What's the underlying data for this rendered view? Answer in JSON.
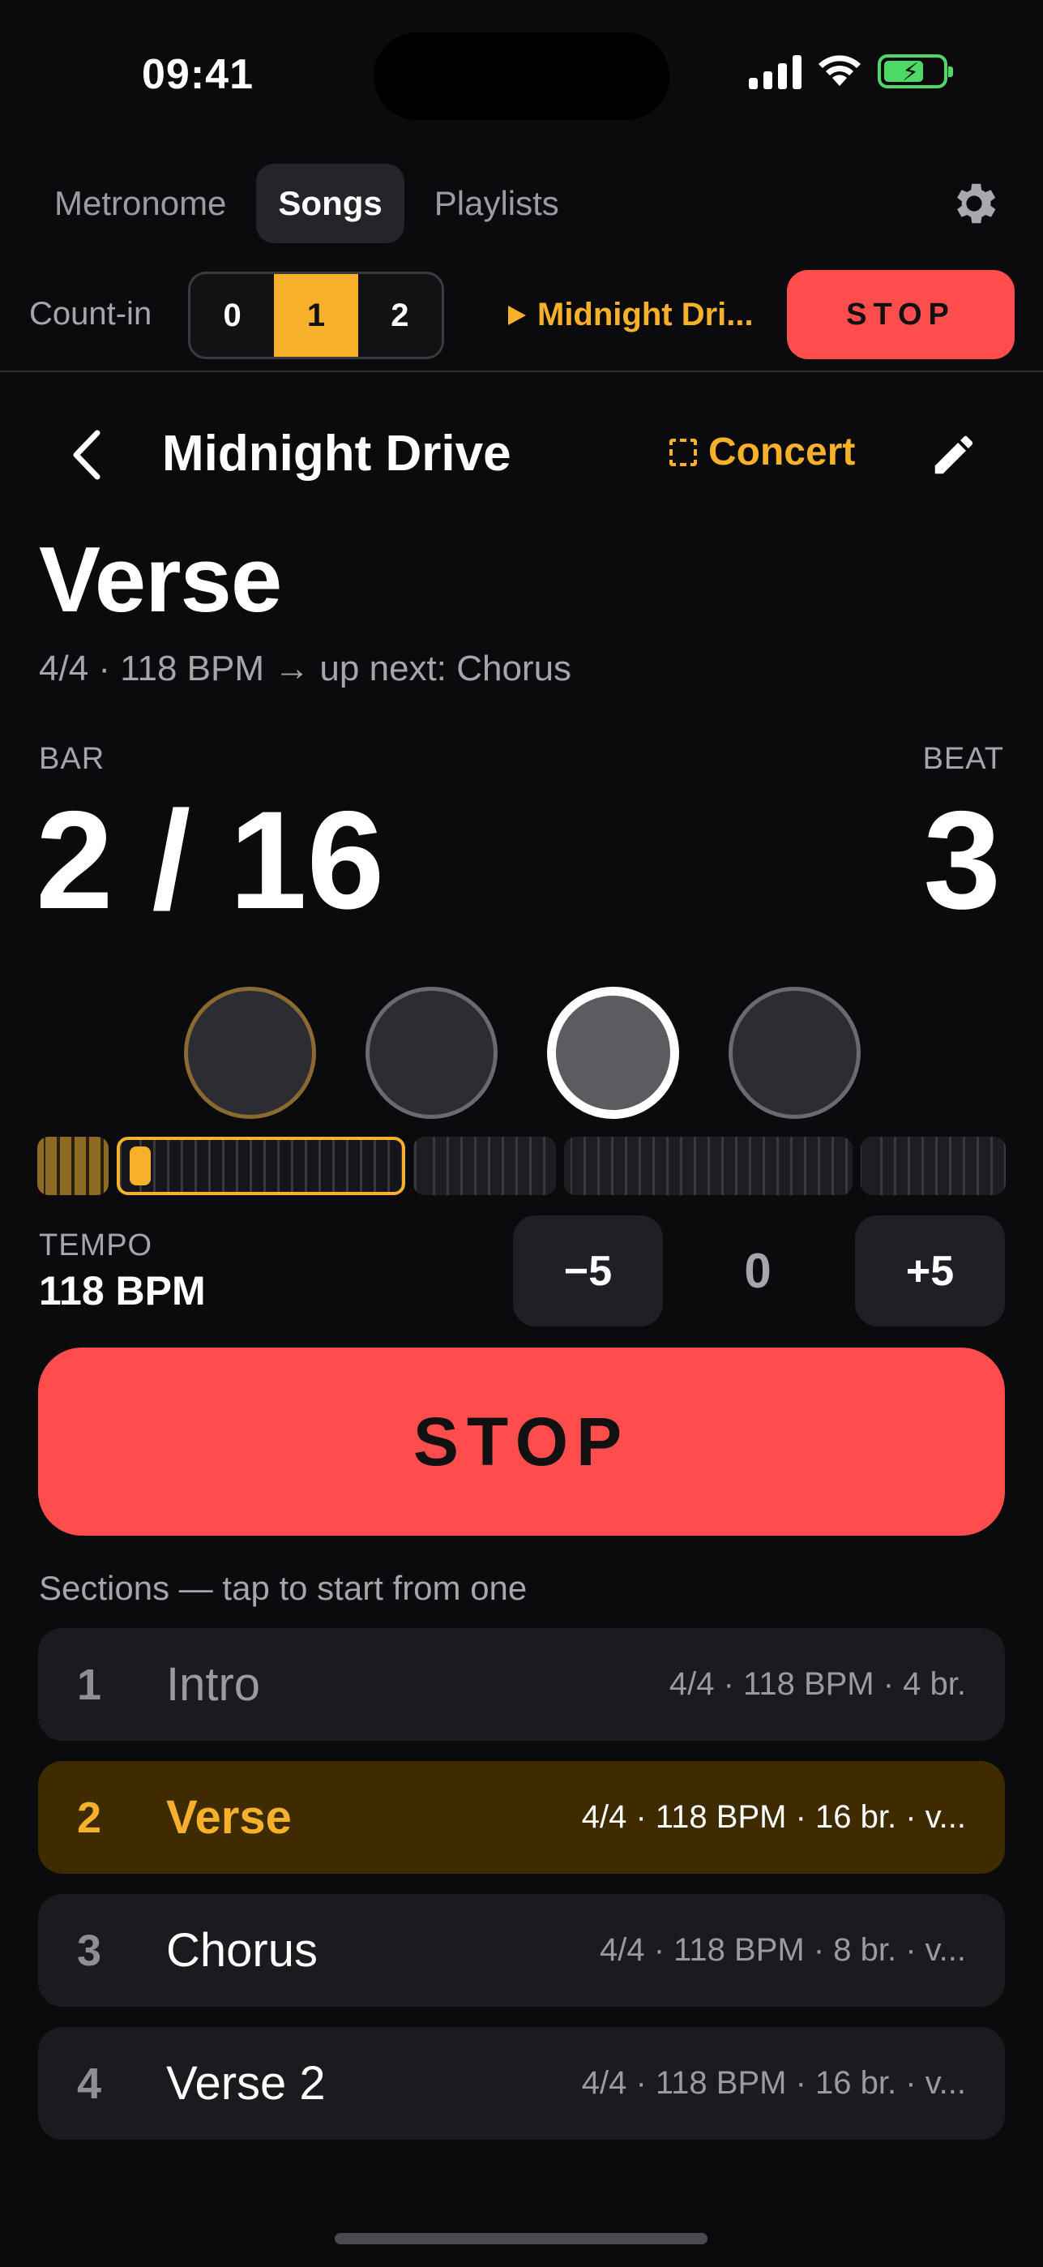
{
  "status": {
    "time": "09:41"
  },
  "nav": {
    "tabs": [
      "Metronome",
      "Songs",
      "Playlists"
    ],
    "active": "Songs"
  },
  "countin": {
    "label": "Count-in",
    "options": [
      "0",
      "1",
      "2"
    ],
    "selected": "1"
  },
  "now_playing": {
    "title": "Midnight Dri...",
    "stop_label": "STOP"
  },
  "song": {
    "title": "Midnight Drive",
    "concert_label": "Concert"
  },
  "current_section": {
    "name": "Verse",
    "meta": "4/4 · 118 BPM  →  up next: Chorus"
  },
  "position": {
    "bar_label": "BAR",
    "bar_value": "2 / 16",
    "beat_label": "BEAT",
    "beat_value": "3",
    "beats_per_bar": 4,
    "current_beat": 3
  },
  "tempo": {
    "label": "TEMPO",
    "value": "118 BPM",
    "minus_label": "−5",
    "offset": "0",
    "plus_label": "+5"
  },
  "transport": {
    "stop_label": "STOP"
  },
  "sections": {
    "hint": "Sections — tap to start from one",
    "items": [
      {
        "num": "1",
        "name": "Intro",
        "info": "4/4 · 118 BPM · 4 br."
      },
      {
        "num": "2",
        "name": "Verse",
        "info": "4/4 · 118 BPM · 16 br. · v..."
      },
      {
        "num": "3",
        "name": "Chorus",
        "info": "4/4 · 118 BPM · 8 br. · v..."
      },
      {
        "num": "4",
        "name": "Verse 2",
        "info": "4/4 · 118 BPM · 16 br. · v..."
      }
    ]
  },
  "colors": {
    "accent": "#f7b02a",
    "stop": "#ff4d4d",
    "background": "#0b0b0d",
    "active_row": "#3e2b00"
  }
}
